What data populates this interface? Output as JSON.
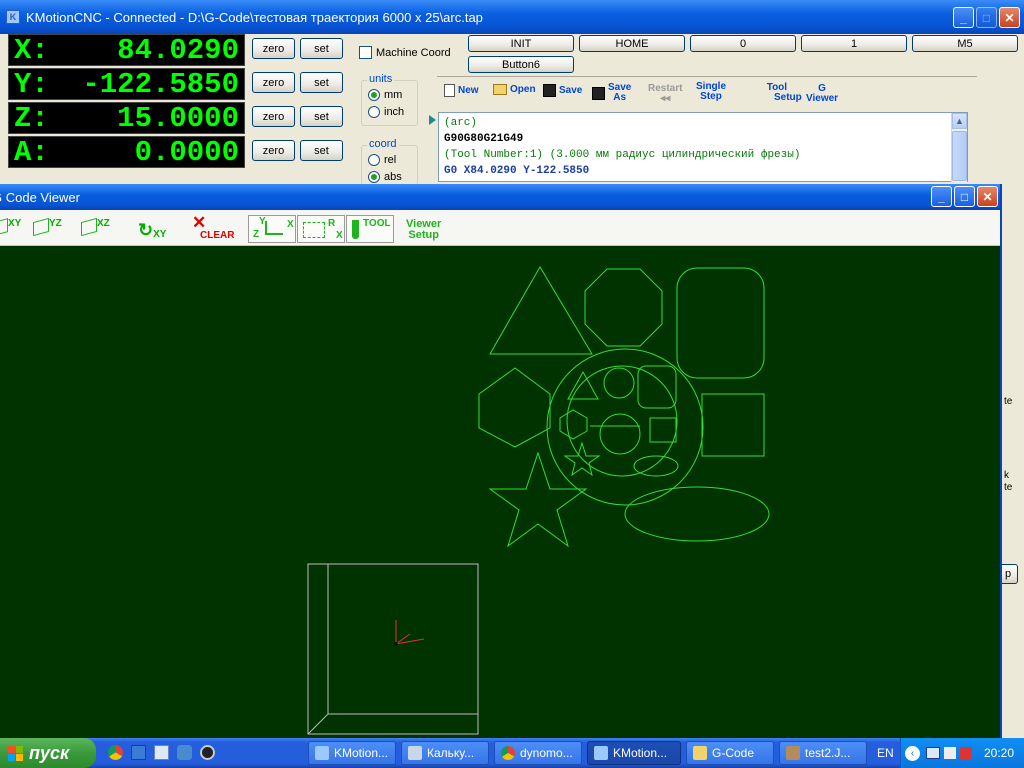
{
  "main_window": {
    "title": "KMotionCNC - Connected - D:\\G-Code\\тестовая траектория 6000 x 25\\arc.tap"
  },
  "dro": [
    {
      "axis": "X:",
      "value": "84.0290"
    },
    {
      "axis": "Y:",
      "value": "-122.5850"
    },
    {
      "axis": "Z:",
      "value": "15.0000"
    },
    {
      "axis": "A:",
      "value": "0.0000"
    }
  ],
  "dro_buttons": {
    "zero": "zero",
    "set": "set"
  },
  "machine_coord": {
    "label": "Machine Coord",
    "checked": false
  },
  "units": {
    "label": "units",
    "mm": "mm",
    "inch": "inch",
    "selected": "mm"
  },
  "coord": {
    "label": "coord",
    "rel": "rel",
    "abs": "abs",
    "selected": "abs"
  },
  "user_buttons": [
    "INIT",
    "HOME",
    "0",
    "1",
    "M5",
    "Button6"
  ],
  "toolbar": {
    "new": "New",
    "open": "Open",
    "save": "Save",
    "save_as_1": "Save",
    "save_as_2": "As",
    "restart": "Restart",
    "single_step_1": "Single",
    "single_step_2": "Step",
    "tool_setup_1": "Tool",
    "tool_setup_2": "Setup",
    "g_viewer_1": "G",
    "g_viewer_2": "Viewer"
  },
  "gcode_lines": [
    "(arc)",
    "G90G80G21G49",
    "(Tool Number:1) (3.000 мм радиус цилиндрический фрезы)",
    "G0 X84.0290 Y-122.5850"
  ],
  "viewer": {
    "title": "G Code Viewer",
    "tools": {
      "xy": "XY",
      "yz": "YZ",
      "xz": "XZ",
      "rot_xy": "XY",
      "clear": "CLEAR",
      "yzx_y": "Y",
      "yzx_x": "X",
      "yzx_z": "Z",
      "box_r": "R",
      "box_x": "X",
      "tool": "TOOL",
      "viewer_setup_1": "Viewer",
      "viewer_setup_2": "Setup"
    },
    "bg_color": "#003300",
    "path_color": "#33DD33"
  },
  "side_peek": {
    "line1": "te",
    "line2": "k",
    "line3": "te",
    "button": "p"
  },
  "taskbar": {
    "start": "пуск",
    "tasks": [
      "KMotion...",
      "Кальку...",
      "dynomo...",
      "KMotion...",
      "G-Code",
      "test2.J..."
    ],
    "active_task_index": 3,
    "lang": "EN",
    "clock": "20:20"
  }
}
